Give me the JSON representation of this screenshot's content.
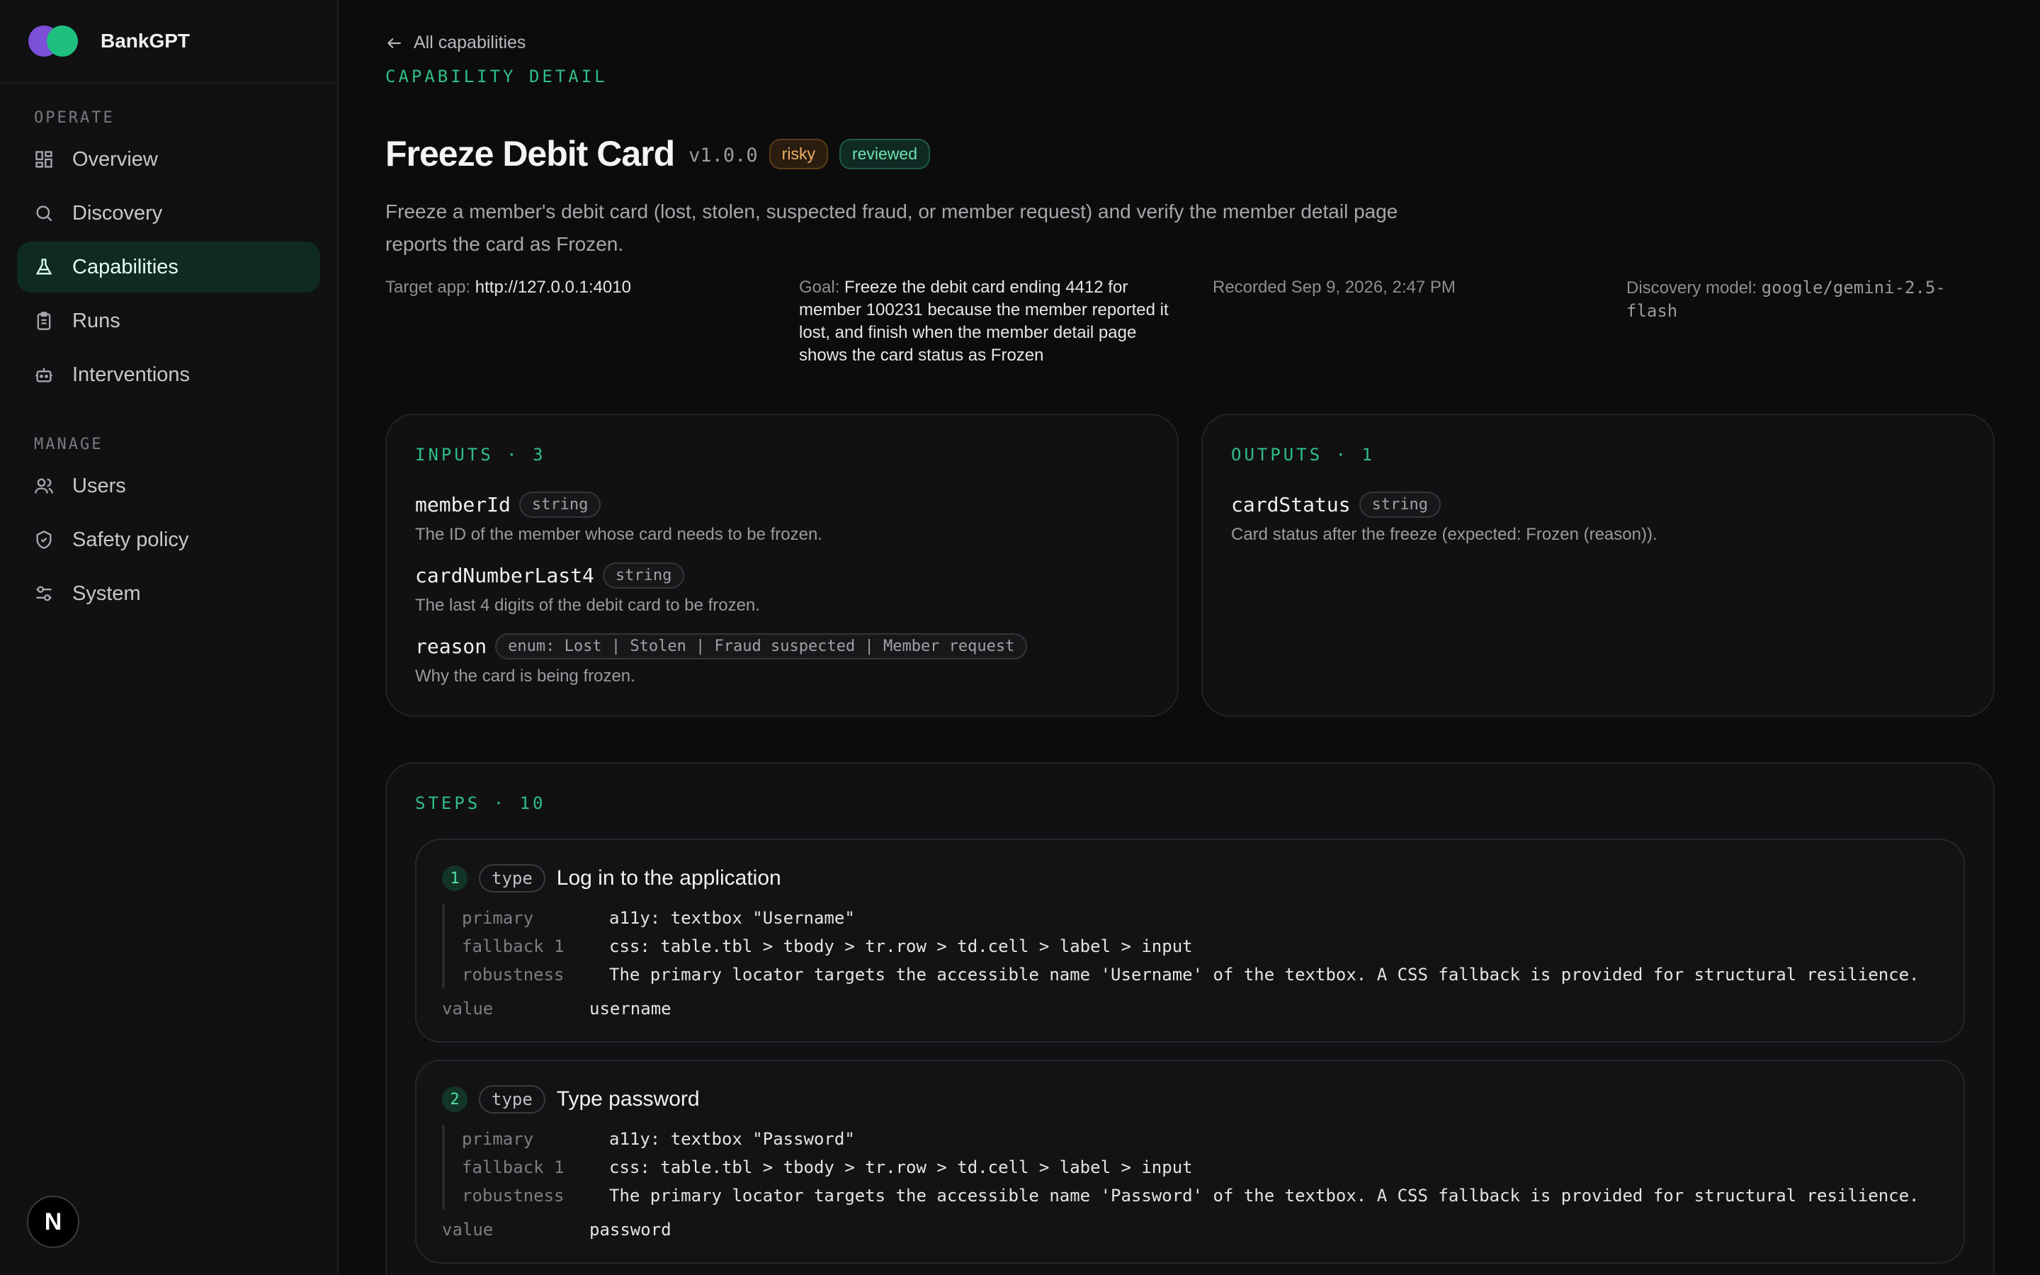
{
  "app": {
    "name": "BankGPT",
    "avatar_letter": "N"
  },
  "sidebar": {
    "operate_label": "OPERATE",
    "manage_label": "MANAGE",
    "operate_items": [
      {
        "label": "Overview",
        "icon": "grid-icon"
      },
      {
        "label": "Discovery",
        "icon": "search-icon"
      },
      {
        "label": "Capabilities",
        "icon": "flask-icon",
        "active": true
      },
      {
        "label": "Runs",
        "icon": "clipboard-icon"
      },
      {
        "label": "Interventions",
        "icon": "robot-icon"
      }
    ],
    "manage_items": [
      {
        "label": "Users",
        "icon": "users-icon"
      },
      {
        "label": "Safety policy",
        "icon": "shield-icon"
      },
      {
        "label": "System",
        "icon": "sliders-icon"
      }
    ]
  },
  "header": {
    "back_label": "All capabilities",
    "eyebrow": "CAPABILITY DETAIL",
    "title": "Freeze Debit Card",
    "version": "v1.0.0",
    "badges": [
      "risky",
      "reviewed"
    ],
    "description": "Freeze a member's debit card (lost, stolen, suspected fraud, or member request) and verify the member detail page reports the card as Frozen."
  },
  "meta": {
    "target_label": "Target app:",
    "target_value": "http://127.0.0.1:4010",
    "goal_label": "Goal:",
    "goal_value": "Freeze the debit card ending 4412 for member 100231 because the member reported it lost, and finish when the member detail page shows the card status as Frozen",
    "recorded": "Recorded Sep 9, 2026, 2:47 PM",
    "model_label": "Discovery model:",
    "model_value": "google/gemini-2.5-flash"
  },
  "inputs": {
    "label": "INPUTS · 3",
    "fields": [
      {
        "name": "memberId",
        "type": "string",
        "desc": "The ID of the member whose card needs to be frozen."
      },
      {
        "name": "cardNumberLast4",
        "type": "string",
        "desc": "The last 4 digits of the debit card to be frozen."
      },
      {
        "name": "reason",
        "type": "enum: Lost | Stolen | Fraud suspected | Member request",
        "desc": "Why the card is being frozen."
      }
    ]
  },
  "outputs": {
    "label": "OUTPUTS · 1",
    "fields": [
      {
        "name": "cardStatus",
        "type": "string",
        "desc": "Card status after the freeze (expected: Frozen (reason))."
      }
    ]
  },
  "steps": {
    "label": "STEPS · 10",
    "items": [
      {
        "num": "1",
        "type": "type",
        "title": "Log in to the application",
        "primary_k": "primary",
        "primary_v": "a11y: textbox \"Username\"",
        "fallback_k": "fallback 1",
        "fallback_v": "css: table.tbl > tbody > tr.row > td.cell > label > input",
        "robust_k": "robustness",
        "robust_v": "The primary locator targets the accessible name 'Username' of the textbox. A CSS fallback is provided for structural resilience.",
        "value_k": "value",
        "value_v": "username"
      },
      {
        "num": "2",
        "type": "type",
        "title": "Type password",
        "primary_k": "primary",
        "primary_v": "a11y: textbox \"Password\"",
        "fallback_k": "fallback 1",
        "fallback_v": "css: table.tbl > tbody > tr.row > td.cell > label > input",
        "robust_k": "robustness",
        "robust_v": "The primary locator targets the accessible name 'Password' of the textbox. A CSS fallback is provided for structural resilience.",
        "value_k": "value",
        "value_v": "password"
      }
    ]
  },
  "colors": {
    "accent": "#2fbf86",
    "brand_purple": "#7b4fd6",
    "brand_green": "#1fbf7f",
    "risky": "#f0b066"
  }
}
